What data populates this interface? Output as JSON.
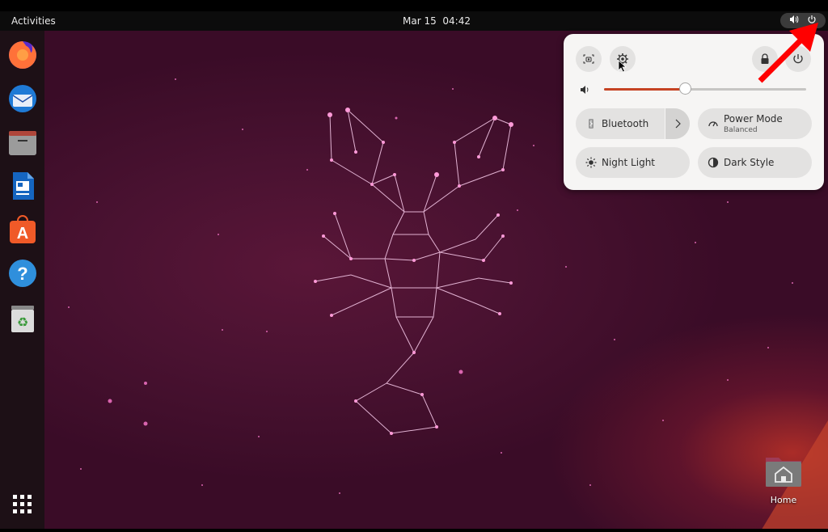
{
  "topbar": {
    "activities_label": "Activities",
    "date": "Mar 15",
    "time": "04:42",
    "status_icons": [
      "volume-icon",
      "power-icon"
    ]
  },
  "dock": {
    "apps": [
      {
        "name": "Firefox",
        "icon": "firefox-icon"
      },
      {
        "name": "Thunderbird",
        "icon": "thunderbird-icon"
      },
      {
        "name": "Files",
        "icon": "files-icon"
      },
      {
        "name": "LibreOffice Writer",
        "icon": "writer-icon"
      },
      {
        "name": "Ubuntu Software",
        "icon": "software-icon"
      },
      {
        "name": "Help",
        "icon": "help-icon"
      },
      {
        "name": "Trash",
        "icon": "trash-icon"
      }
    ],
    "show_apps_icon": "grid-icon"
  },
  "quick_settings": {
    "top_buttons": [
      "screenshot-icon",
      "settings-icon",
      "lock-icon",
      "power-icon"
    ],
    "volume_level": 0.4,
    "toggles": {
      "bluetooth": {
        "label": "Bluetooth"
      },
      "power_mode": {
        "label": "Power Mode",
        "sub": "Balanced"
      },
      "night_light": {
        "label": "Night Light"
      },
      "dark_style": {
        "label": "Dark Style"
      }
    }
  },
  "desktop": {
    "home_label": "Home"
  },
  "colors": {
    "accent": "#c54323",
    "annotation_arrow": "#ff0000",
    "panel_bg": "#f6f5f4",
    "constellation": "#ff9ad8"
  }
}
